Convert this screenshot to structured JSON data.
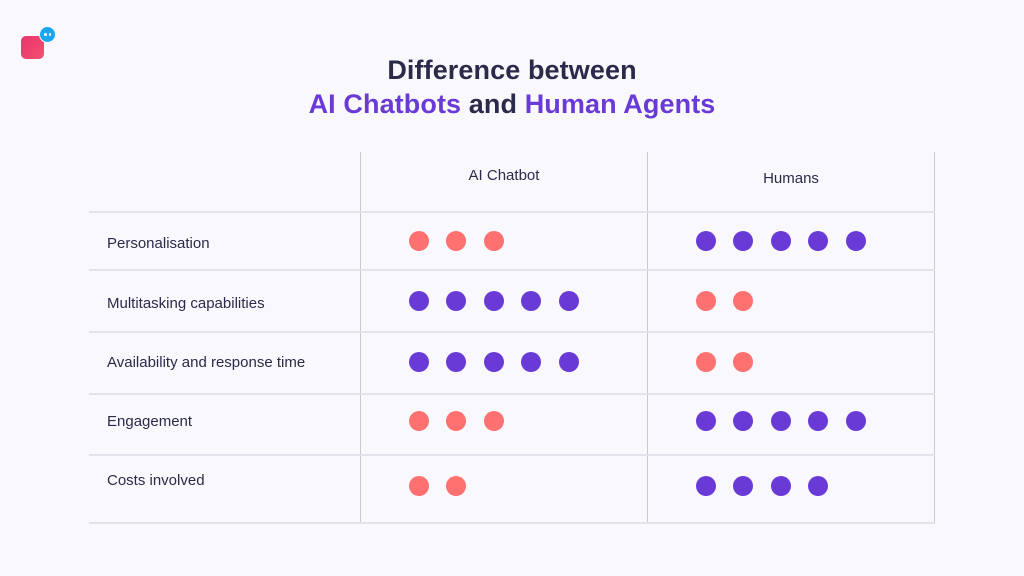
{
  "brand": {
    "logo_icon": "chat-bubble-logo-icon",
    "colors": {
      "logo_square": "#e8356d",
      "logo_bubble": "#1ca6ee"
    }
  },
  "title": {
    "line1": "Difference between",
    "line2_part1": "AI Chatbots",
    "line2_part2": " and ",
    "line2_part3": "Human Agents"
  },
  "colors": {
    "text": "#2b2a4a",
    "accent": "#6a3ad6",
    "high_dot": "#6a3ad6",
    "low_dot": "#ff7070",
    "background": "#f9f9fd"
  },
  "chart_data": {
    "type": "table",
    "title": "Difference between AI Chatbots and Human Agents",
    "columns": [
      "AI Chatbot",
      "Humans"
    ],
    "rows": [
      {
        "label": "Personalisation",
        "values": [
          3,
          5
        ]
      },
      {
        "label": "Multitasking capabilities",
        "values": [
          5,
          2
        ]
      },
      {
        "label": "Availability and response time",
        "values": [
          5,
          2
        ]
      },
      {
        "label": "Engagement",
        "values": [
          3,
          5
        ]
      },
      {
        "label": "Costs involved",
        "values": [
          2,
          4
        ]
      }
    ],
    "scale_max": 5,
    "encoding": "dot count; purple = higher score, coral = lower score"
  }
}
